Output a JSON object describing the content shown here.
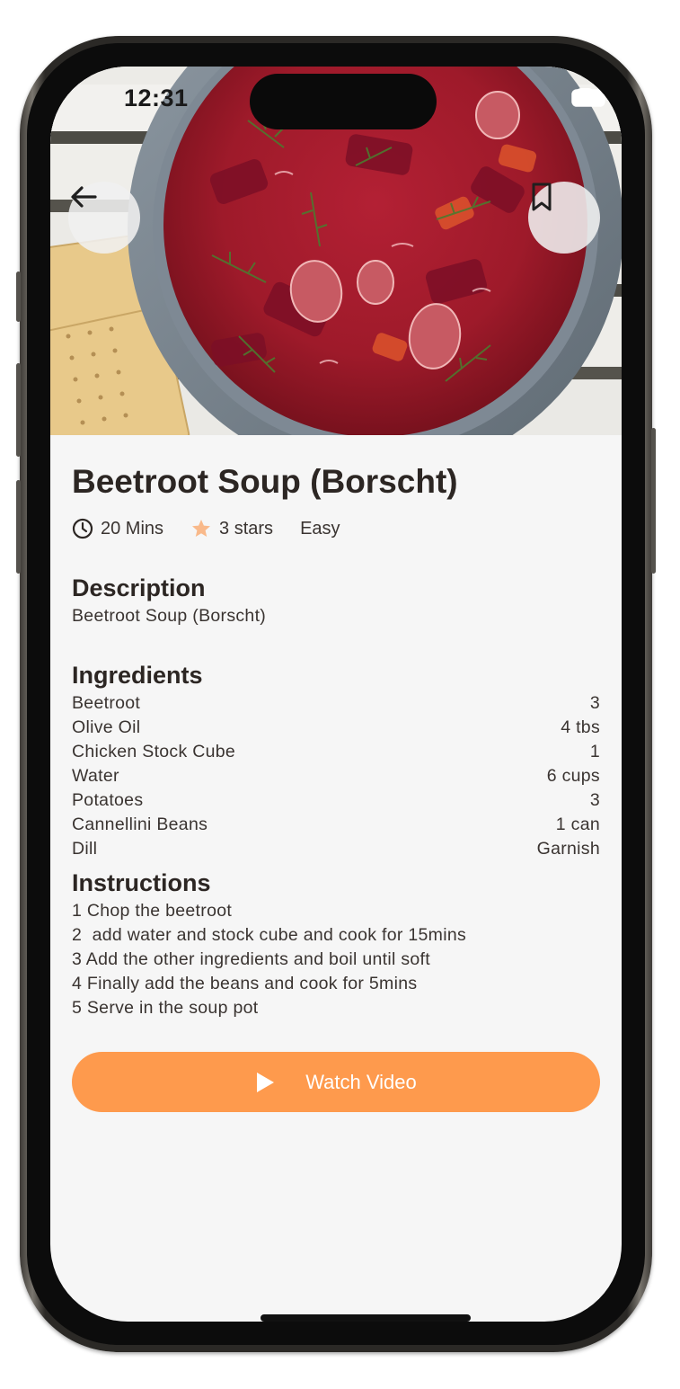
{
  "status_bar": {
    "time": "12:31"
  },
  "recipe": {
    "title": "Beetroot Soup (Borscht)",
    "time": "20 Mins",
    "rating": "3 stars",
    "difficulty": "Easy"
  },
  "description": {
    "heading": "Description",
    "text": "Beetroot Soup (Borscht)"
  },
  "ingredients": {
    "heading": "Ingredients",
    "items": [
      {
        "name": "Beetroot",
        "amount": "3"
      },
      {
        "name": "Olive Oil",
        "amount": "4 tbs"
      },
      {
        "name": "Chicken Stock Cube",
        "amount": "1"
      },
      {
        "name": "Water",
        "amount": "6 cups"
      },
      {
        "name": "Potatoes",
        "amount": "3"
      },
      {
        "name": "Cannellini Beans",
        "amount": "1 can"
      },
      {
        "name": "Dill",
        "amount": "Garnish"
      }
    ]
  },
  "instructions": {
    "heading": "Instructions",
    "steps": [
      "1 Chop the beetroot",
      "2  add water and stock cube and cook for 15mins",
      "3 Add the other ingredients and boil until soft",
      "4 Finally add the beans and cook for 5mins",
      "5 Serve in the soup pot"
    ]
  },
  "watch_button": {
    "label": "Watch Video"
  },
  "icons": {
    "back": "arrow-left-icon",
    "bookmark": "bookmark-icon",
    "clock": "clock-icon",
    "star": "star-icon",
    "play": "play-icon",
    "wifi": "wifi-icon",
    "battery": "battery-icon"
  },
  "colors": {
    "accent": "#fe9a4d",
    "star": "#f9b98a",
    "text_dark": "#2c2623",
    "background": "#f6f6f6"
  }
}
